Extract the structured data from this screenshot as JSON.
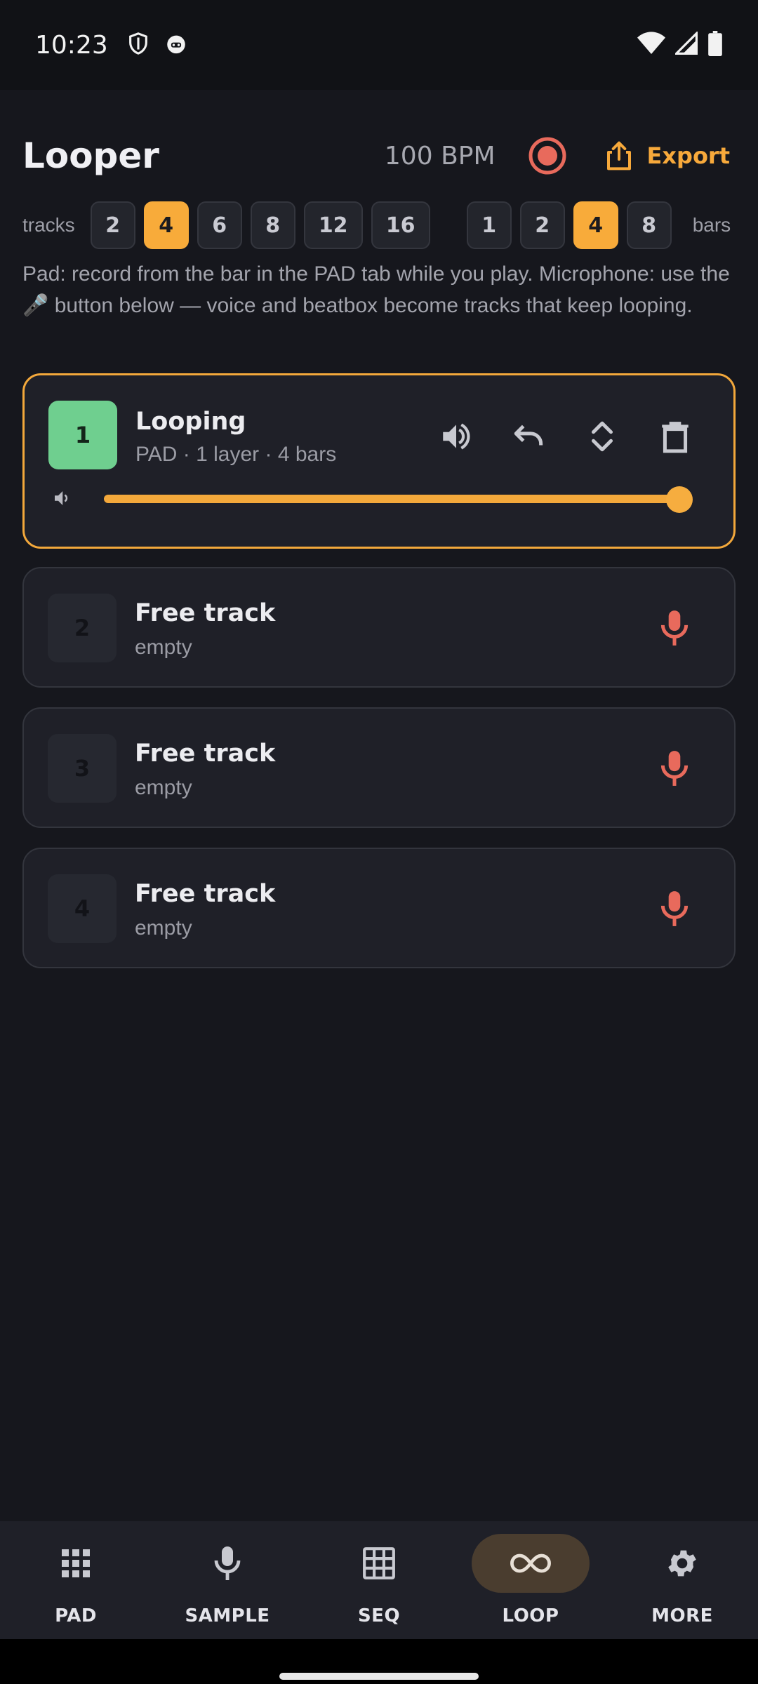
{
  "status_bar": {
    "time": "10:23"
  },
  "header": {
    "title": "Looper",
    "bpm": "100 BPM",
    "export_label": "Export",
    "accent_color": "#f7a93b"
  },
  "tracks_selector": {
    "label": "tracks",
    "options": [
      "2",
      "4",
      "6",
      "8",
      "12",
      "16"
    ],
    "selected": "4"
  },
  "bars_selector": {
    "label": "bars",
    "options": [
      "1",
      "2",
      "4",
      "8"
    ],
    "selected": "4"
  },
  "help_text": "Pad: record from the bar in the PAD tab while you play. Microphone: use the 🎤 button below — voice and beatbox become tracks that keep looping.",
  "tracks": [
    {
      "number": "1",
      "title": "Looping",
      "subtitle": "PAD · 1 layer · 4 bars",
      "state": "active",
      "volume_fraction": 1.0
    },
    {
      "number": "2",
      "title": "Free track",
      "subtitle": "empty",
      "state": "empty"
    },
    {
      "number": "3",
      "title": "Free track",
      "subtitle": "empty",
      "state": "empty"
    },
    {
      "number": "4",
      "title": "Free track",
      "subtitle": "empty",
      "state": "empty"
    }
  ],
  "nav": {
    "items": [
      {
        "label": "PAD",
        "icon": "grid-dots-icon"
      },
      {
        "label": "SAMPLE",
        "icon": "mic-icon"
      },
      {
        "label": "SEQ",
        "icon": "grid-icon"
      },
      {
        "label": "LOOP",
        "icon": "infinity-icon",
        "active": true
      },
      {
        "label": "MORE",
        "icon": "gear-icon"
      }
    ]
  }
}
